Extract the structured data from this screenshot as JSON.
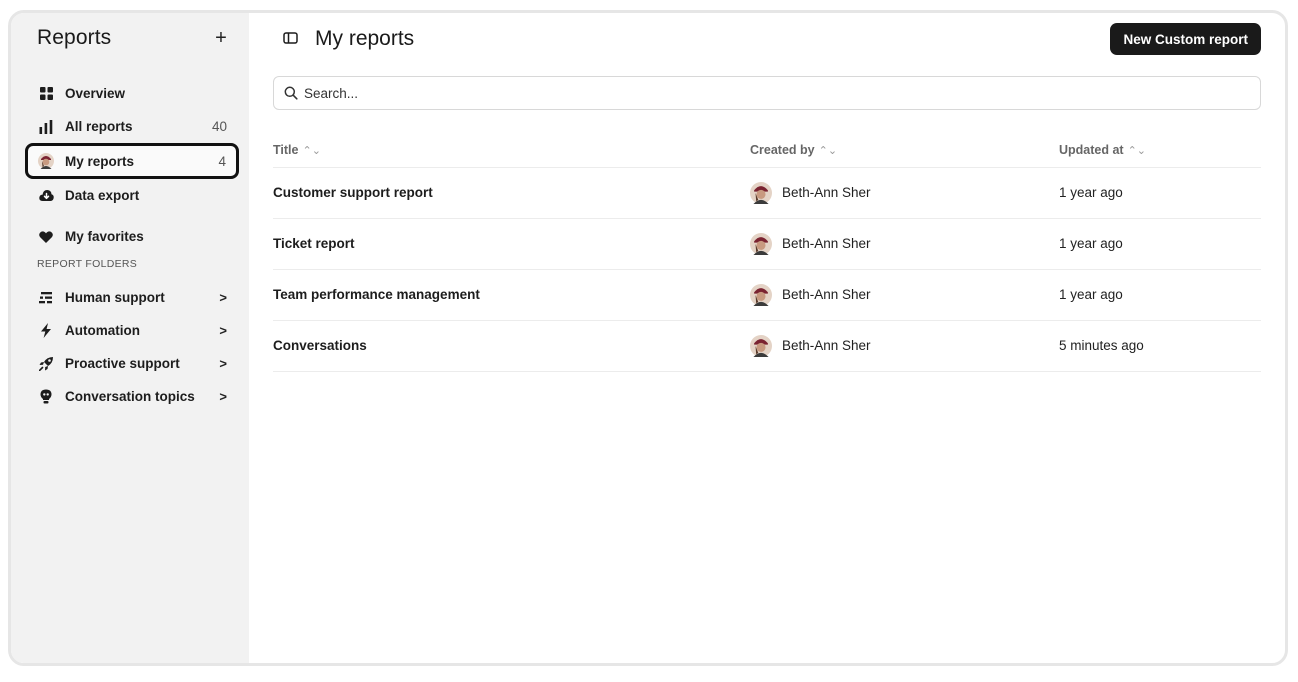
{
  "sidebar": {
    "title": "Reports",
    "add_label": "+",
    "items": [
      {
        "label": "Overview",
        "icon": "grid-icon"
      },
      {
        "label": "All reports",
        "icon": "bar-chart-icon",
        "count": "40"
      },
      {
        "label": "My reports",
        "icon": "avatar-icon",
        "count": "4"
      },
      {
        "label": "Data export",
        "icon": "cloud-download-icon"
      },
      {
        "label": "My favorites",
        "icon": "heart-icon"
      }
    ],
    "section_label": "REPORT FOLDERS",
    "folders": [
      {
        "label": "Human support",
        "icon": "stairs-icon",
        "chevron": ">"
      },
      {
        "label": "Automation",
        "icon": "lightning-icon",
        "chevron": ">"
      },
      {
        "label": "Proactive support",
        "icon": "rocket-icon",
        "chevron": ">"
      },
      {
        "label": "Conversation topics",
        "icon": "lightbulb-icon",
        "chevron": ">"
      }
    ]
  },
  "header": {
    "title": "My reports",
    "new_button": "New Custom report"
  },
  "search": {
    "placeholder": "Search..."
  },
  "table": {
    "columns": [
      "Title",
      "Created by",
      "Updated at"
    ],
    "sort_glyph": "⌃⌄",
    "rows": [
      {
        "title": "Customer support report",
        "created_by": "Beth-Ann Sher",
        "updated_at": "1 year ago"
      },
      {
        "title": "Ticket report",
        "created_by": "Beth-Ann Sher",
        "updated_at": "1 year ago"
      },
      {
        "title": "Team performance management",
        "created_by": "Beth-Ann Sher",
        "updated_at": "1 year ago"
      },
      {
        "title": "Conversations",
        "created_by": "Beth-Ann Sher",
        "updated_at": "5 minutes ago"
      }
    ]
  },
  "colors": {
    "sidebar_bg": "#f2f2f2",
    "primary_button": "#1a1a1a",
    "active_outline": "#111111"
  }
}
